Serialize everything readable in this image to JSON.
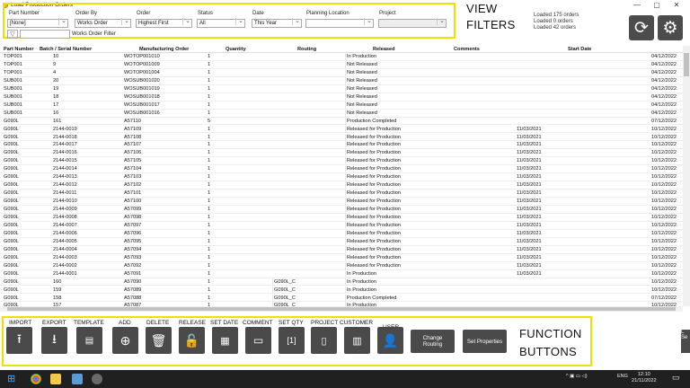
{
  "window": {
    "title": "Load Production Orders",
    "min_glyph": "—",
    "max_glyph": "▢",
    "close_glyph": "✕"
  },
  "filters": {
    "part_number": {
      "label": "Part Number",
      "value": "[None]"
    },
    "order_by": {
      "label": "Order By",
      "value": "Works Order"
    },
    "order": {
      "label": "Order",
      "value": "Highest First"
    },
    "status": {
      "label": "Status",
      "value": "All"
    },
    "date": {
      "label": "Date",
      "value": "This Year"
    },
    "planning_location": {
      "label": "Planning Location",
      "value": ""
    },
    "project": {
      "label": "Project",
      "value": ""
    },
    "works_order_filter": {
      "label": "Works Order Filter",
      "value": ""
    }
  },
  "annotations": {
    "view_filters_line1": "VIEW",
    "view_filters_line2": "FILTERS",
    "function_buttons_line1": "FUNCTION",
    "function_buttons_line2": "BUTTONS"
  },
  "status_lines": [
    "Loaded 175 orders",
    "Loaded 0 orders",
    "Loaded 42 orders"
  ],
  "table": {
    "headers": {
      "part": "Part Number",
      "batch": "Batch / Serial Number",
      "mo": "Manufacturing Order",
      "qty": "Quantity",
      "route": "Routing",
      "rel": "Released",
      "comm": "Comments",
      "start": "Start Date"
    },
    "rows": [
      {
        "part": "TOP001",
        "batch": "10",
        "mo": "WOTOP001010",
        "qty": "1",
        "route": "",
        "rel": "In Production",
        "due": "",
        "start": "04/12/2022"
      },
      {
        "part": "TOP001",
        "batch": "9",
        "mo": "WOTOP001009",
        "qty": "1",
        "route": "",
        "rel": "Not Released",
        "due": "",
        "start": "04/12/2022"
      },
      {
        "part": "TOP001",
        "batch": "4",
        "mo": "WOTOP001004",
        "qty": "1",
        "route": "",
        "rel": "Not Released",
        "due": "",
        "start": "04/12/2022"
      },
      {
        "part": "SUB001",
        "batch": "20",
        "mo": "WOSUB001020",
        "qty": "1",
        "route": "",
        "rel": "Not Released",
        "due": "",
        "start": "04/12/2022"
      },
      {
        "part": "SUB001",
        "batch": "19",
        "mo": "WOSUB001019",
        "qty": "1",
        "route": "",
        "rel": "Not Released",
        "due": "",
        "start": "04/12/2022"
      },
      {
        "part": "SUB001",
        "batch": "18",
        "mo": "WOSUB001018",
        "qty": "1",
        "route": "",
        "rel": "Not Released",
        "due": "",
        "start": "04/12/2022"
      },
      {
        "part": "SUB001",
        "batch": "17",
        "mo": "WOSUB001017",
        "qty": "1",
        "route": "",
        "rel": "Not Released",
        "due": "",
        "start": "04/12/2022"
      },
      {
        "part": "SUB001",
        "batch": "16",
        "mo": "WOSUB001016",
        "qty": "1",
        "route": "",
        "rel": "Not Released",
        "due": "",
        "start": "04/12/2022"
      },
      {
        "part": "G090L",
        "batch": "161",
        "mo": "A57110",
        "qty": "5",
        "route": "",
        "rel": "Production Completed",
        "due": "",
        "start": "07/12/2022"
      },
      {
        "part": "G090L",
        "batch": "2144-0019",
        "mo": "A57109",
        "qty": "1",
        "route": "",
        "rel": "Released for Production",
        "due": "11/03/2021",
        "start": "10/12/2022"
      },
      {
        "part": "G090L",
        "batch": "2144-0018",
        "mo": "A57108",
        "qty": "1",
        "route": "",
        "rel": "Released for Production",
        "due": "11/03/2021",
        "start": "10/12/2022"
      },
      {
        "part": "G090L",
        "batch": "2144-0017",
        "mo": "A57107",
        "qty": "1",
        "route": "",
        "rel": "Released for Production",
        "due": "11/03/2021",
        "start": "10/12/2022"
      },
      {
        "part": "G090L",
        "batch": "2144-0016",
        "mo": "A57106",
        "qty": "1",
        "route": "",
        "rel": "Released for Production",
        "due": "11/03/2021",
        "start": "10/12/2022"
      },
      {
        "part": "G090L",
        "batch": "2144-0015",
        "mo": "A57105",
        "qty": "1",
        "route": "",
        "rel": "Released for Production",
        "due": "11/03/2021",
        "start": "10/12/2022"
      },
      {
        "part": "G090L",
        "batch": "2144-0014",
        "mo": "A57104",
        "qty": "1",
        "route": "",
        "rel": "Released for Production",
        "due": "11/03/2021",
        "start": "10/12/2022"
      },
      {
        "part": "G090L",
        "batch": "2144-0013",
        "mo": "A57103",
        "qty": "1",
        "route": "",
        "rel": "Released for Production",
        "due": "11/03/2021",
        "start": "10/12/2022"
      },
      {
        "part": "G090L",
        "batch": "2144-0012",
        "mo": "A57102",
        "qty": "1",
        "route": "",
        "rel": "Released for Production",
        "due": "11/03/2021",
        "start": "10/12/2022"
      },
      {
        "part": "G090L",
        "batch": "2144-0011",
        "mo": "A57101",
        "qty": "1",
        "route": "",
        "rel": "Released for Production",
        "due": "11/03/2021",
        "start": "10/12/2022"
      },
      {
        "part": "G090L",
        "batch": "2144-0010",
        "mo": "A57100",
        "qty": "1",
        "route": "",
        "rel": "Released for Production",
        "due": "11/03/2021",
        "start": "10/12/2022"
      },
      {
        "part": "G090L",
        "batch": "2144-0009",
        "mo": "A57099",
        "qty": "1",
        "route": "",
        "rel": "Released for Production",
        "due": "11/03/2021",
        "start": "10/12/2022"
      },
      {
        "part": "G090L",
        "batch": "2144-0008",
        "mo": "A57098",
        "qty": "1",
        "route": "",
        "rel": "Released for Production",
        "due": "11/03/2021",
        "start": "10/12/2022"
      },
      {
        "part": "G090L",
        "batch": "2144-0007",
        "mo": "A57097",
        "qty": "1",
        "route": "",
        "rel": "Released for Production",
        "due": "11/03/2021",
        "start": "10/12/2022"
      },
      {
        "part": "G090L",
        "batch": "2144-0006",
        "mo": "A57096",
        "qty": "1",
        "route": "",
        "rel": "Released for Production",
        "due": "11/03/2021",
        "start": "10/12/2022"
      },
      {
        "part": "G090L",
        "batch": "2144-0005",
        "mo": "A57095",
        "qty": "1",
        "route": "",
        "rel": "Released for Production",
        "due": "11/03/2021",
        "start": "10/12/2022"
      },
      {
        "part": "G090L",
        "batch": "2144-0004",
        "mo": "A57094",
        "qty": "1",
        "route": "",
        "rel": "Released for Production",
        "due": "11/03/2021",
        "start": "10/12/2022"
      },
      {
        "part": "G090L",
        "batch": "2144-0003",
        "mo": "A57093",
        "qty": "1",
        "route": "",
        "rel": "Released for Production",
        "due": "11/03/2021",
        "start": "10/12/2022"
      },
      {
        "part": "G090L",
        "batch": "2144-0002",
        "mo": "A57092",
        "qty": "1",
        "route": "",
        "rel": "Released for Production",
        "due": "11/03/2021",
        "start": "10/12/2022"
      },
      {
        "part": "G090L",
        "batch": "2144-0001",
        "mo": "A57091",
        "qty": "1",
        "route": "",
        "rel": "In Production",
        "due": "11/03/2021",
        "start": "10/12/2022"
      },
      {
        "part": "G090L",
        "batch": "160",
        "mo": "A57090",
        "qty": "1",
        "route": "G090L_C",
        "rel": "In Production",
        "due": "",
        "start": "10/12/2022"
      },
      {
        "part": "G090L",
        "batch": "159",
        "mo": "A57089",
        "qty": "1",
        "route": "G090L_C",
        "rel": "In Production",
        "due": "",
        "start": "10/12/2022"
      },
      {
        "part": "G090L",
        "batch": "158",
        "mo": "A57088",
        "qty": "1",
        "route": "G090L_C",
        "rel": "Production Completed",
        "due": "",
        "start": "07/12/2022"
      },
      {
        "part": "G090L",
        "batch": "157",
        "mo": "A57087",
        "qty": "1",
        "route": "G090L_C",
        "rel": "In Production",
        "due": "",
        "start": "10/12/2022"
      }
    ]
  },
  "toolbar": {
    "import": "IMPORT",
    "export": "EXPORT",
    "template": "TEMPLATE",
    "add": "ADD",
    "delete": "DELETE",
    "release": "RELEASE",
    "set_date": "SET DATE",
    "comment": "COMMENT",
    "set_qty": "SET QTY",
    "project": "PROJECT",
    "customer": "CUSTOMER",
    "user": "USER",
    "change_routing": "Change Routing",
    "set_properties": "Set Properties",
    "edge_label": "L Se"
  },
  "taskbar": {
    "lang": "ENG",
    "time": "12:10",
    "date": "21/11/2022"
  },
  "colors": {
    "highlight_border": "#f0e000",
    "button_bg": "#4a4a4a",
    "taskbar_bg": "#202020"
  }
}
